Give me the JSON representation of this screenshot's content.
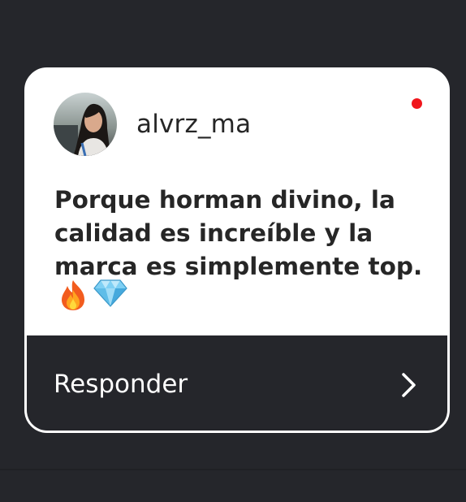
{
  "message_card": {
    "username": "alvrz_ma",
    "message_text": "Porque horman divino, la calidad es increíble y la marca es simplemente top.",
    "emojis": [
      "fire-emoji",
      "gem-emoji"
    ],
    "unread": true,
    "reply_label": "Responder"
  },
  "colors": {
    "background": "#25262b",
    "card": "#ffffff",
    "text": "#262626",
    "unread_dot": "#f0161c"
  },
  "icons": [
    "avatar",
    "chevron-right-icon",
    "fire-emoji",
    "gem-emoji"
  ]
}
